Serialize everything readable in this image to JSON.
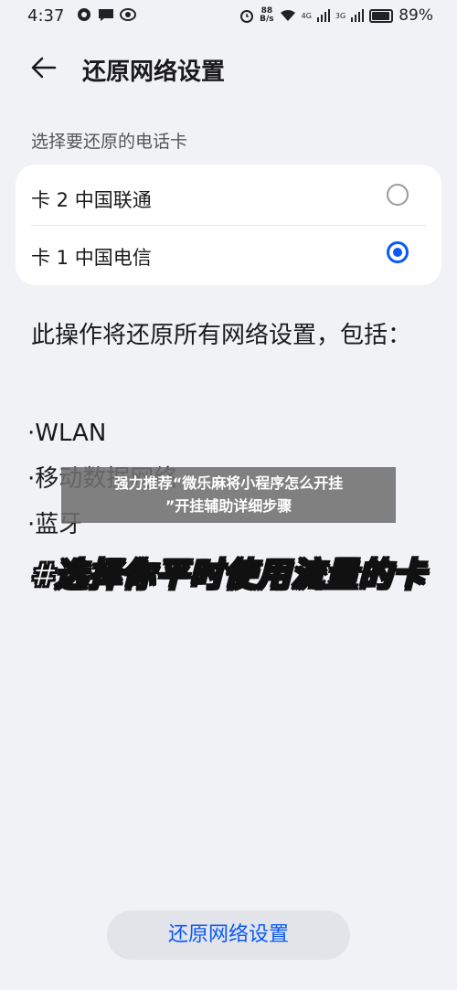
{
  "status_bar": {
    "time": "4:37",
    "left_icons": [
      "message-icon",
      "chat-icon",
      "eye-icon"
    ],
    "speed_value": "88",
    "speed_unit": "B/s",
    "network_1": "4G",
    "network_2": "3G",
    "battery": "89%",
    "battery_level": 0.89
  },
  "header": {
    "title": "还原网络设置"
  },
  "sim_section": {
    "label": "选择要还原的电话卡",
    "items": [
      {
        "label": "卡 2 中国联通",
        "selected": false
      },
      {
        "label": "卡 1 中国电信",
        "selected": true
      }
    ]
  },
  "description": "此操作将还原所有网络设置，包括：",
  "bullets": [
    "·WLAN",
    "·移动数据网络",
    "·蓝牙"
  ],
  "overlay": {
    "line1": "强力推荐“微乐麻将小程序怎么开挂",
    "line2": "”开挂辅助详细步骤"
  },
  "caption": "#选择你平时使用流量的卡",
  "reset_button": "还原网络设置",
  "colors": {
    "accent": "#0a59f7",
    "background": "#f1f2f6"
  }
}
